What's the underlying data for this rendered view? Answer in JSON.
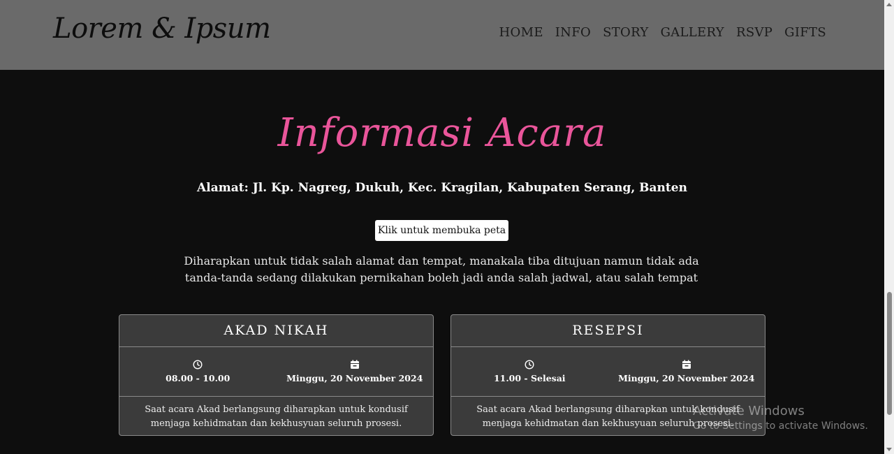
{
  "brand": "Lorem & Ipsum",
  "nav": [
    "HOME",
    "INFO",
    "STORY",
    "GALLERY",
    "RSVP",
    "GIFTS"
  ],
  "section": {
    "title": "Informasi Acara",
    "address": "Alamat: Jl. Kp. Nagreg, Dukuh, Kec. Kragilan, Kabupaten Serang, Banten",
    "map_button": "Klik untuk membuka peta",
    "notice": "Diharapkan untuk tidak salah alamat dan tempat, manakala tiba ditujuan namun tidak ada tanda-tanda sedang dilakukan pernikahan boleh jadi anda salah jadwal, atau salah tempat"
  },
  "cards": [
    {
      "title": "AKAD NIKAH",
      "time": "08.00 - 10.00",
      "date": "Minggu, 20 November 2024",
      "description": "Saat acara Akad berlangsung diharapkan untuk kondusif menjaga kehidmatan dan kekhusyuan seluruh prosesi.",
      "icons": [
        "clock-icon",
        "calendar-icon"
      ]
    },
    {
      "title": "RESEPSI",
      "time": "11.00 - Selesai",
      "date": "Minggu, 20 November 2024",
      "description": "Saat acara Akad berlangsung diharapkan untuk kondusif menjaga kehidmatan dan kekhusyuan seluruh prosesi.",
      "icons": [
        "clock-icon",
        "calendar-icon"
      ]
    }
  ],
  "watermark": {
    "line1": "Activate Windows",
    "line2": "Go to Settings to activate Windows."
  },
  "colors": {
    "accent": "#e9559a",
    "navbar": "#6a6a6a",
    "background": "#0e0e0e",
    "card": "#3b3b3b"
  }
}
